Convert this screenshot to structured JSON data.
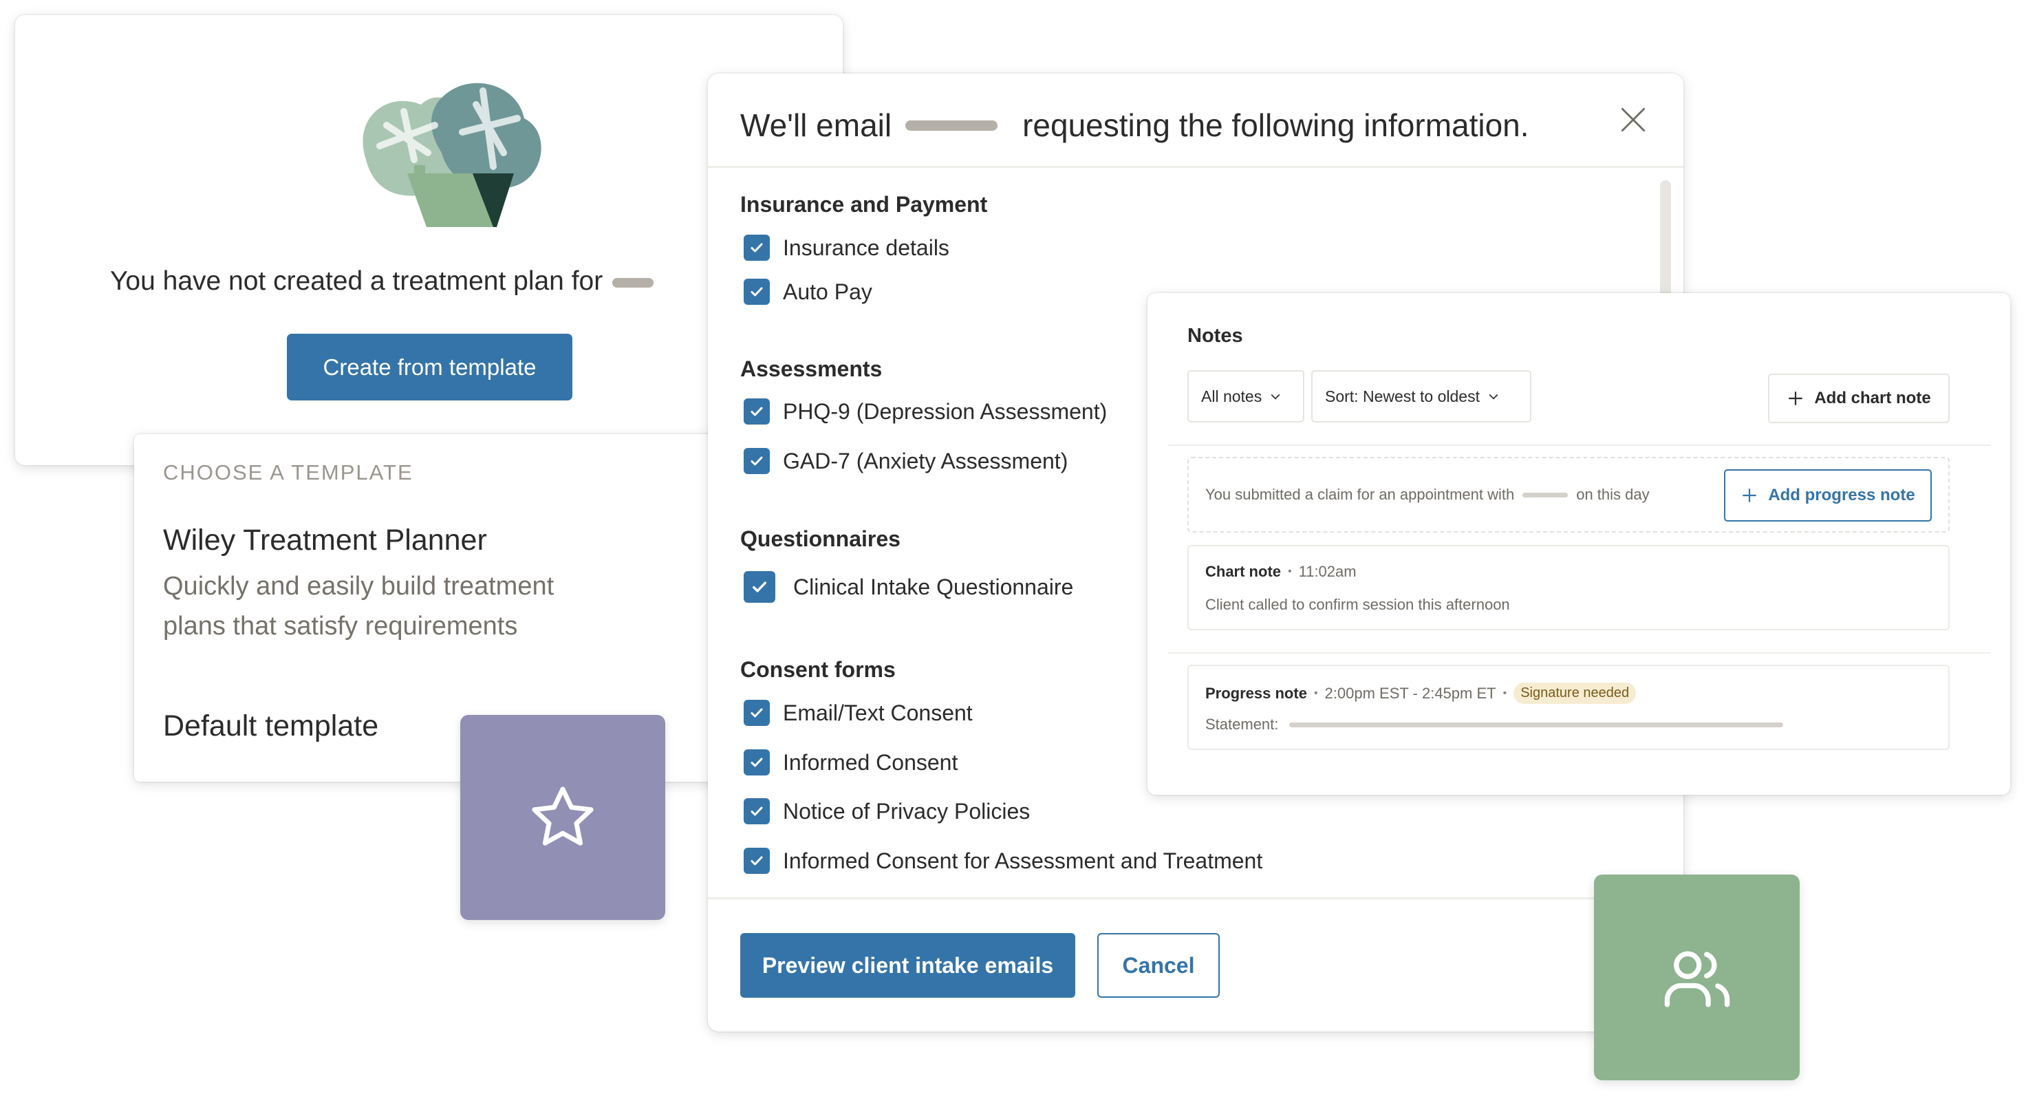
{
  "treatment_plan_card": {
    "message": "You have not created a treatment plan for",
    "create_button": "Create from template"
  },
  "template_chooser": {
    "heading": "CHOOSE A TEMPLATE",
    "options": [
      {
        "name": "Wiley Treatment Planner",
        "description": "Quickly and easily build treatment plans that satisfy requirements"
      },
      {
        "name": "Default template"
      }
    ]
  },
  "intake_modal": {
    "title_prefix": "We'll email",
    "title_suffix": "requesting the following information.",
    "sections": [
      {
        "title": "Insurance and Payment",
        "items": [
          {
            "label": "Insurance details",
            "checked": true
          },
          {
            "label": "Auto Pay",
            "checked": true
          }
        ]
      },
      {
        "title": "Assessments",
        "items": [
          {
            "label": "PHQ-9 (Depression Assessment)",
            "checked": true
          },
          {
            "label": "GAD-7 (Anxiety Assessment)",
            "checked": true
          }
        ]
      },
      {
        "title": "Questionnaires",
        "items": [
          {
            "label": "Clinical Intake Questionnaire",
            "checked": true
          }
        ]
      },
      {
        "title": "Consent forms",
        "items": [
          {
            "label": "Email/Text Consent",
            "checked": true
          },
          {
            "label": "Informed Consent",
            "checked": true
          },
          {
            "label": "Notice of Privacy Policies",
            "checked": true
          },
          {
            "label": "Informed Consent for Assessment and Treatment",
            "checked": true
          }
        ]
      }
    ],
    "preview_button": "Preview client intake emails",
    "cancel_button": "Cancel"
  },
  "notes_panel": {
    "title": "Notes",
    "filter_value": "All notes",
    "sort_value": "Sort: Newest to oldest",
    "add_chart_note": "Add chart note",
    "claim_prefix": "You submitted a claim for an appointment with",
    "claim_suffix": "on this day",
    "add_progress_note": "Add progress note",
    "chart_note": {
      "type": "Chart note",
      "time": "11:02am",
      "body": "Client called to confirm session this afternoon"
    },
    "progress_note": {
      "type": "Progress note",
      "time": "2:00pm EST - 2:45pm ET",
      "badge": "Signature needed",
      "statement_label": "Statement:"
    }
  },
  "colors": {
    "primary": "#3574a8",
    "star_tile": "#918fb3",
    "people_tile": "#8eb38f",
    "badge_bg": "#f6ecd2"
  },
  "icons": {
    "close": "close-icon",
    "star": "star-icon",
    "people": "users-icon",
    "chevron": "chevron-down-icon",
    "plus": "plus-icon",
    "check": "check-icon"
  }
}
